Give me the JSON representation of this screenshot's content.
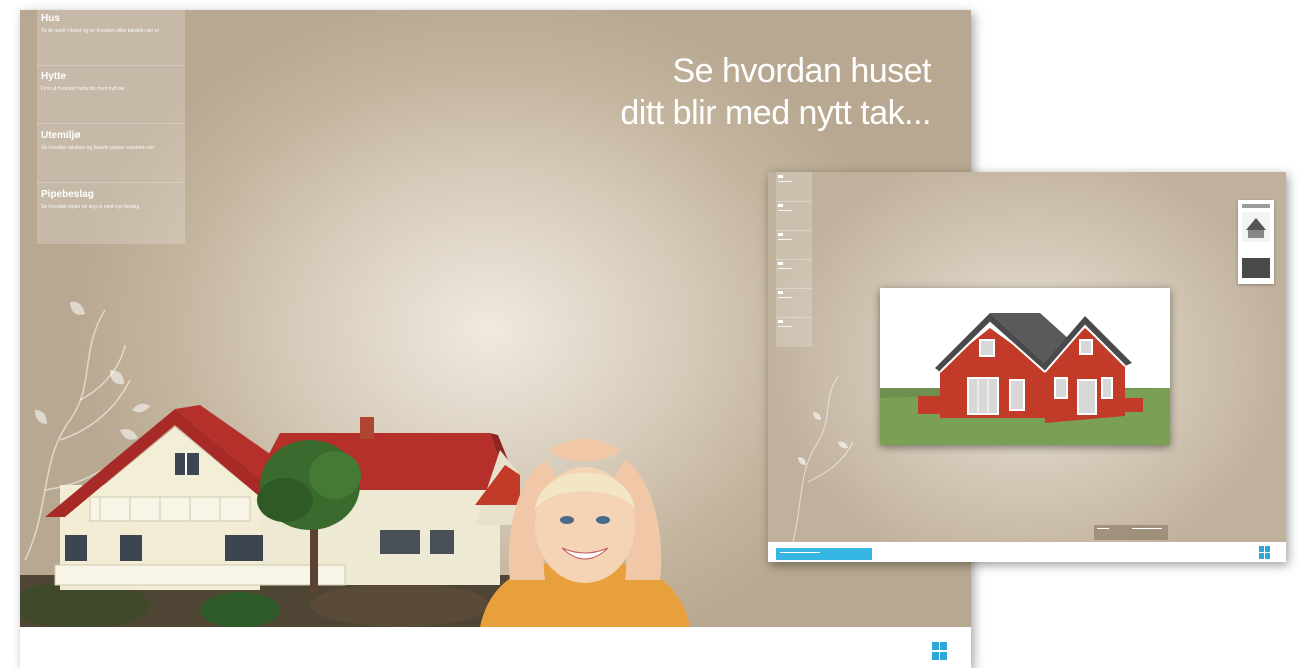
{
  "main": {
    "headline_line1": "Se hvordan huset",
    "headline_line2": "ditt blir med nytt tak...",
    "menu": [
      {
        "title": "Hus",
        "subtitle": "Ta litt rundt i huset og se hvordan ulike takstein ser ut"
      },
      {
        "title": "Hytte",
        "subtitle": "Finn ut hvordan hytta blir med nytt tak"
      },
      {
        "title": "Utemiljø",
        "subtitle": "Se hvordan takstein og fasade passer sammen ute"
      },
      {
        "title": "Pipebeslag",
        "subtitle": "Se hvordan pipen tar seg ut med nye beslag"
      }
    ]
  },
  "colors": {
    "background": "#c8baa5",
    "roof_red": "#b5302a",
    "house_red": "#c23a28",
    "logo_blue": "#2ba8d8"
  },
  "icons": {
    "logo": "tile-logo-icon"
  }
}
